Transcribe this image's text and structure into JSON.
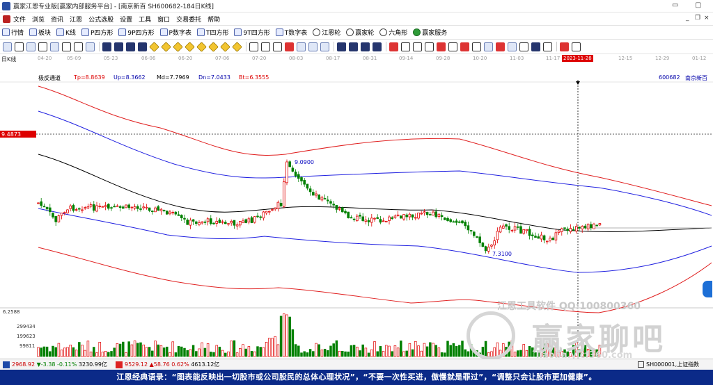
{
  "window": {
    "title": "赢家江恩专业版[赢家内部服务平台] - [南京新百  SH600682-184日K线]"
  },
  "menu": [
    "文件",
    "浏览",
    "资讯",
    "江恩",
    "公式选股",
    "设置",
    "工具",
    "窗口",
    "交易委托",
    "帮助"
  ],
  "toolbar1": [
    {
      "label": "行情",
      "icon": "grid-icon"
    },
    {
      "label": "板块",
      "icon": "cube-icon"
    },
    {
      "label": "K线",
      "icon": "kline-icon"
    },
    {
      "label": "P四方形",
      "icon": "p-square-icon"
    },
    {
      "label": "9P四方形",
      "icon": "9p-square-icon"
    },
    {
      "label": "P数字表",
      "icon": "p-table-icon"
    },
    {
      "label": "T四方形",
      "icon": "t-square-icon"
    },
    {
      "label": "9T四方形",
      "icon": "9t-square-icon"
    },
    {
      "label": "T数字表",
      "icon": "t-table-icon"
    },
    {
      "label": "江恩轮",
      "icon": "wheel-icon"
    },
    {
      "label": "赢家轮",
      "icon": "wheel2-icon"
    },
    {
      "label": "六角形",
      "icon": "hexagon-icon"
    },
    {
      "label": "赢家服务",
      "icon": "dollar-icon"
    }
  ],
  "timeline": {
    "kind_label": "日K线",
    "ticks": [
      "04-20",
      "05-09",
      "05-23",
      "06-06",
      "06-20",
      "07-06",
      "07-20",
      "08-03",
      "08-17",
      "08-31",
      "09-14",
      "09-28",
      "10-20",
      "11-03",
      "11-17",
      "12-15",
      "12-29",
      "01-12"
    ],
    "cursor_date": "2023-11-28"
  },
  "indicator": {
    "name": "极反通道",
    "tp": "Tp=8.8639",
    "up": "Up=8.3662",
    "md": "Md=7.7969",
    "dn": "Dn=7.0433",
    "bt": "Bt=6.3555",
    "code": "600682",
    "stock": "南京新百"
  },
  "chart_data": {
    "type": "line",
    "cursor_price_label": "9.4873",
    "high_label": "9.0900",
    "low_label": "7.3100",
    "volume_ticks": [
      "6.2588",
      "299434",
      "199623",
      "99811"
    ],
    "colors": {
      "tp": "#e02020",
      "up": "#2020e0",
      "md": "#000000",
      "bt": "#e02020",
      "dn": "#2020e0",
      "up_candle": "#e00000",
      "down_candle": "#008000"
    }
  },
  "statusbar": {
    "sh_index": "2968.92",
    "sh_change": "▼-3.38",
    "sh_pct": "-0.11%",
    "sh_amount": "3230.99亿",
    "sz_index": "9529.12",
    "sz_change": "▲58.76",
    "sz_pct": "0.62%",
    "sz_amount": "4613.12亿",
    "index_name": "SH000001,上证指数"
  },
  "watermark": {
    "line1": "江恩工具软件 QQ:100800360",
    "line2": "赢家聊吧",
    "line3": "liaoba.yjcf360.com"
  },
  "quote": "江恩经典语录：“图表能反映出一切股市或公司股民的总体心理状况”，“不要一次性买进，傲慢就是罪过”，“调整只会让股市更加健康”。"
}
